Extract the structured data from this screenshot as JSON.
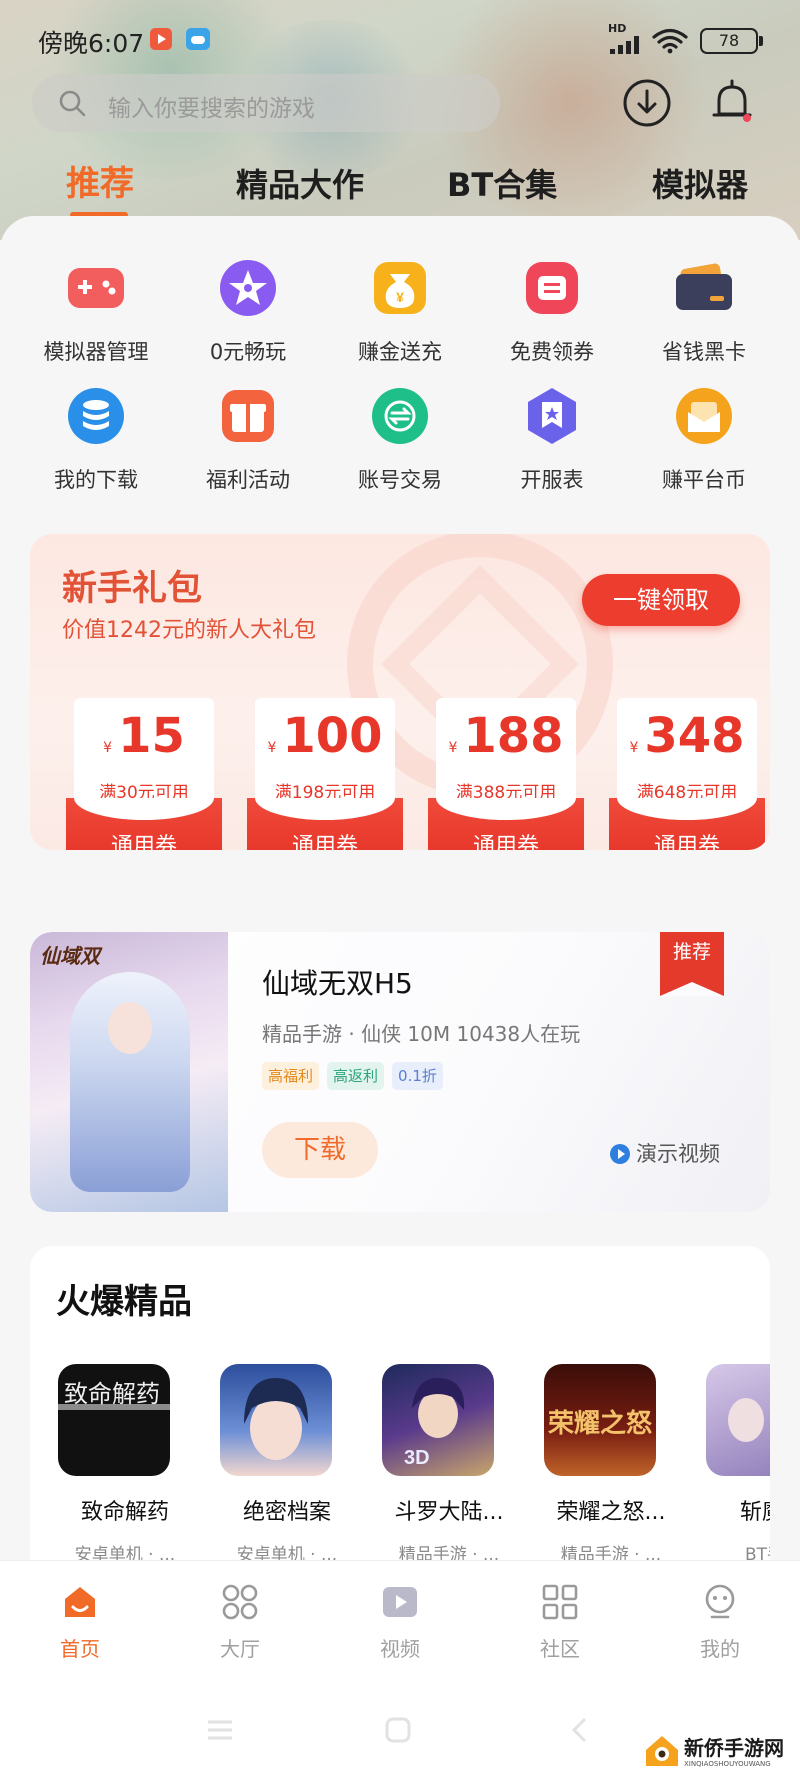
{
  "status_bar": {
    "time": "傍晚6:07",
    "network": "HD",
    "battery": "78"
  },
  "search": {
    "placeholder": "输入你要搜索的游戏"
  },
  "tabs": [
    {
      "label": "推荐",
      "active": true
    },
    {
      "label": "精品大作",
      "active": false
    },
    {
      "label": "BT合集",
      "active": false
    },
    {
      "label": "模拟器",
      "active": false
    }
  ],
  "quick_actions": [
    {
      "label": "模拟器管理",
      "icon": "gamepad-icon",
      "color": "#f25e5e"
    },
    {
      "label": "0元畅玩",
      "icon": "star-icon",
      "color": "#8a5bf0"
    },
    {
      "label": "赚金送充",
      "icon": "money-bag-icon",
      "color": "#f7b21b"
    },
    {
      "label": "免费领券",
      "icon": "coupon-icon",
      "color": "#f0465a"
    },
    {
      "label": "省钱黑卡",
      "icon": "card-icon",
      "color": "#3b3f5c"
    },
    {
      "label": "我的下载",
      "icon": "database-icon",
      "color": "#2a8fe8"
    },
    {
      "label": "福利活动",
      "icon": "gift-icon",
      "color": "#f2633e"
    },
    {
      "label": "账号交易",
      "icon": "exchange-icon",
      "color": "#1fbf8a"
    },
    {
      "label": "开服表",
      "icon": "badge-icon",
      "color": "#6a62e8"
    },
    {
      "label": "赚平台币",
      "icon": "envelope-icon",
      "color": "#f5a21c"
    }
  ],
  "newbie_gift": {
    "title": "新手礼包",
    "subtitle": "价值1242元的新人大礼包",
    "button": "一键领取",
    "coupons": [
      {
        "currency": "¥",
        "amount": "15",
        "condition": "满30元可用",
        "type": "通用券"
      },
      {
        "currency": "¥",
        "amount": "100",
        "condition": "满198元可用",
        "type": "通用券"
      },
      {
        "currency": "¥",
        "amount": "188",
        "condition": "满388元可用",
        "type": "通用券"
      },
      {
        "currency": "¥",
        "amount": "348",
        "condition": "满648元可用",
        "type": "通用券"
      }
    ]
  },
  "featured": {
    "cover_logo": "仙域双",
    "name": "仙域无双H5",
    "meta": "精品手游 · 仙侠  10M  10438人在玩",
    "tags": [
      "高福利",
      "高返利",
      "0.1折"
    ],
    "download": "下载",
    "demo": "演示视频",
    "ribbon": "推荐"
  },
  "hot": {
    "title": "火爆精品",
    "games": [
      {
        "name": "致命解药",
        "category": "安卓单机 · ...",
        "cover_text": "致命解药",
        "color": "#111111"
      },
      {
        "name": "绝密档案",
        "category": "安卓单机 · ...",
        "cover_text": "",
        "color": "#3b63b8"
      },
      {
        "name": "斗罗大陆...",
        "category": "精品手游 · ...",
        "cover_text": "3D",
        "color": "#3c2a6e"
      },
      {
        "name": "荣耀之怒...",
        "category": "精品手游 · ...",
        "cover_text": "荣耀之怒",
        "color": "#6b1a12"
      },
      {
        "name": "斩魔问",
        "category": "BT手游",
        "cover_text": "",
        "color": "#8d7bb8"
      }
    ]
  },
  "bottom_nav": [
    {
      "label": "首页",
      "icon": "home-icon",
      "active": true
    },
    {
      "label": "大厅",
      "icon": "grid-circles-icon",
      "active": false
    },
    {
      "label": "视频",
      "icon": "video-icon",
      "active": false
    },
    {
      "label": "社区",
      "icon": "community-icon",
      "active": false
    },
    {
      "label": "我的",
      "icon": "profile-icon",
      "active": false
    }
  ],
  "watermark": {
    "text": "新侨手游网",
    "sub": "XINQIAOSHOUYOUWANG"
  },
  "colors": {
    "accent": "#f26a28",
    "coupon_red": "#e7372a"
  }
}
